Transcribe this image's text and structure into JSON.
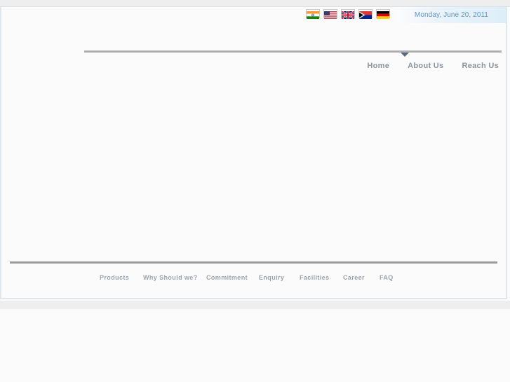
{
  "header": {
    "date": "Monday, June 20, 2011",
    "flags": [
      {
        "name": "flag-india",
        "label": "India"
      },
      {
        "name": "flag-usa",
        "label": "United States"
      },
      {
        "name": "flag-uk",
        "label": "United Kingdom"
      },
      {
        "name": "flag-south-africa",
        "label": "South Africa"
      },
      {
        "name": "flag-germany",
        "label": "Germany"
      }
    ]
  },
  "top_nav": {
    "items": [
      {
        "label": "Home"
      },
      {
        "label": "About Us"
      },
      {
        "label": "Reach Us"
      }
    ]
  },
  "footer_nav": {
    "items": [
      {
        "label": "Products"
      },
      {
        "label": "Why Should we?"
      },
      {
        "label": "Commitment"
      },
      {
        "label": "Enquiry"
      },
      {
        "label": "Facilities"
      },
      {
        "label": "Career"
      },
      {
        "label": "FAQ"
      }
    ]
  },
  "colors": {
    "top_strip": "#eeeeee",
    "container_border": "#dce7f0",
    "page_background": "#fbfbfb",
    "divider": "#b0b0b0",
    "footer_divider": "#9a9a9a",
    "marker": "#556b82",
    "nav_text": "#8a949f",
    "footer_text": "#9aa4ae",
    "date_text": "#5f96bd"
  }
}
